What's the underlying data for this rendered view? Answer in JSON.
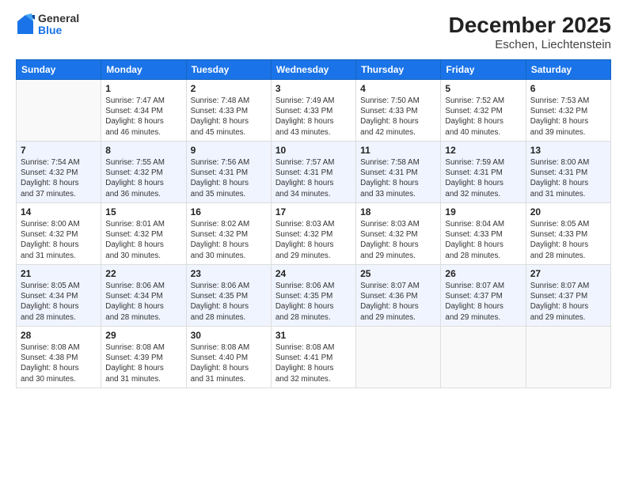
{
  "logo": {
    "general": "General",
    "blue": "Blue"
  },
  "title": "December 2025",
  "subtitle": "Eschen, Liechtenstein",
  "headers": [
    "Sunday",
    "Monday",
    "Tuesday",
    "Wednesday",
    "Thursday",
    "Friday",
    "Saturday"
  ],
  "weeks": [
    [
      {
        "num": "",
        "info": ""
      },
      {
        "num": "1",
        "info": "Sunrise: 7:47 AM\nSunset: 4:34 PM\nDaylight: 8 hours\nand 46 minutes."
      },
      {
        "num": "2",
        "info": "Sunrise: 7:48 AM\nSunset: 4:33 PM\nDaylight: 8 hours\nand 45 minutes."
      },
      {
        "num": "3",
        "info": "Sunrise: 7:49 AM\nSunset: 4:33 PM\nDaylight: 8 hours\nand 43 minutes."
      },
      {
        "num": "4",
        "info": "Sunrise: 7:50 AM\nSunset: 4:33 PM\nDaylight: 8 hours\nand 42 minutes."
      },
      {
        "num": "5",
        "info": "Sunrise: 7:52 AM\nSunset: 4:32 PM\nDaylight: 8 hours\nand 40 minutes."
      },
      {
        "num": "6",
        "info": "Sunrise: 7:53 AM\nSunset: 4:32 PM\nDaylight: 8 hours\nand 39 minutes."
      }
    ],
    [
      {
        "num": "7",
        "info": "Sunrise: 7:54 AM\nSunset: 4:32 PM\nDaylight: 8 hours\nand 37 minutes."
      },
      {
        "num": "8",
        "info": "Sunrise: 7:55 AM\nSunset: 4:32 PM\nDaylight: 8 hours\nand 36 minutes."
      },
      {
        "num": "9",
        "info": "Sunrise: 7:56 AM\nSunset: 4:31 PM\nDaylight: 8 hours\nand 35 minutes."
      },
      {
        "num": "10",
        "info": "Sunrise: 7:57 AM\nSunset: 4:31 PM\nDaylight: 8 hours\nand 34 minutes."
      },
      {
        "num": "11",
        "info": "Sunrise: 7:58 AM\nSunset: 4:31 PM\nDaylight: 8 hours\nand 33 minutes."
      },
      {
        "num": "12",
        "info": "Sunrise: 7:59 AM\nSunset: 4:31 PM\nDaylight: 8 hours\nand 32 minutes."
      },
      {
        "num": "13",
        "info": "Sunrise: 8:00 AM\nSunset: 4:31 PM\nDaylight: 8 hours\nand 31 minutes."
      }
    ],
    [
      {
        "num": "14",
        "info": "Sunrise: 8:00 AM\nSunset: 4:32 PM\nDaylight: 8 hours\nand 31 minutes."
      },
      {
        "num": "15",
        "info": "Sunrise: 8:01 AM\nSunset: 4:32 PM\nDaylight: 8 hours\nand 30 minutes."
      },
      {
        "num": "16",
        "info": "Sunrise: 8:02 AM\nSunset: 4:32 PM\nDaylight: 8 hours\nand 30 minutes."
      },
      {
        "num": "17",
        "info": "Sunrise: 8:03 AM\nSunset: 4:32 PM\nDaylight: 8 hours\nand 29 minutes."
      },
      {
        "num": "18",
        "info": "Sunrise: 8:03 AM\nSunset: 4:32 PM\nDaylight: 8 hours\nand 29 minutes."
      },
      {
        "num": "19",
        "info": "Sunrise: 8:04 AM\nSunset: 4:33 PM\nDaylight: 8 hours\nand 28 minutes."
      },
      {
        "num": "20",
        "info": "Sunrise: 8:05 AM\nSunset: 4:33 PM\nDaylight: 8 hours\nand 28 minutes."
      }
    ],
    [
      {
        "num": "21",
        "info": "Sunrise: 8:05 AM\nSunset: 4:34 PM\nDaylight: 8 hours\nand 28 minutes."
      },
      {
        "num": "22",
        "info": "Sunrise: 8:06 AM\nSunset: 4:34 PM\nDaylight: 8 hours\nand 28 minutes."
      },
      {
        "num": "23",
        "info": "Sunrise: 8:06 AM\nSunset: 4:35 PM\nDaylight: 8 hours\nand 28 minutes."
      },
      {
        "num": "24",
        "info": "Sunrise: 8:06 AM\nSunset: 4:35 PM\nDaylight: 8 hours\nand 28 minutes."
      },
      {
        "num": "25",
        "info": "Sunrise: 8:07 AM\nSunset: 4:36 PM\nDaylight: 8 hours\nand 29 minutes."
      },
      {
        "num": "26",
        "info": "Sunrise: 8:07 AM\nSunset: 4:37 PM\nDaylight: 8 hours\nand 29 minutes."
      },
      {
        "num": "27",
        "info": "Sunrise: 8:07 AM\nSunset: 4:37 PM\nDaylight: 8 hours\nand 29 minutes."
      }
    ],
    [
      {
        "num": "28",
        "info": "Sunrise: 8:08 AM\nSunset: 4:38 PM\nDaylight: 8 hours\nand 30 minutes."
      },
      {
        "num": "29",
        "info": "Sunrise: 8:08 AM\nSunset: 4:39 PM\nDaylight: 8 hours\nand 31 minutes."
      },
      {
        "num": "30",
        "info": "Sunrise: 8:08 AM\nSunset: 4:40 PM\nDaylight: 8 hours\nand 31 minutes."
      },
      {
        "num": "31",
        "info": "Sunrise: 8:08 AM\nSunset: 4:41 PM\nDaylight: 8 hours\nand 32 minutes."
      },
      {
        "num": "",
        "info": ""
      },
      {
        "num": "",
        "info": ""
      },
      {
        "num": "",
        "info": ""
      }
    ]
  ]
}
